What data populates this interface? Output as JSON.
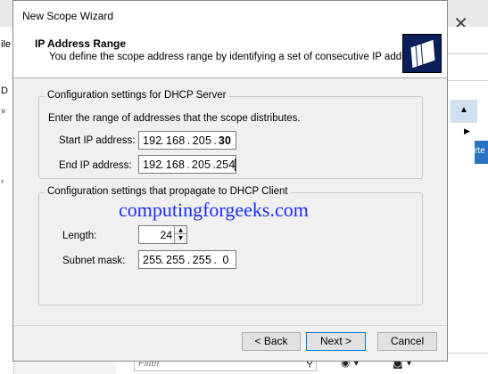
{
  "background": {
    "left_labels": [
      "ile",
      "D"
    ],
    "right_blue_text": "rte",
    "filter_placeholder": "Filter"
  },
  "dialog": {
    "title": "New Scope Wizard",
    "header": {
      "title": "IP Address Range",
      "description": "You define the scope address range by identifying a set of consecutive IP addresses."
    },
    "server_group": {
      "legend": "Configuration settings for DHCP Server",
      "instruction": "Enter the range of addresses that the scope distributes.",
      "start_label": "Start IP address:",
      "start_ip": [
        "192",
        "168",
        "205",
        "30"
      ],
      "end_label": "End IP address:",
      "end_ip": [
        "192",
        "168",
        "205",
        "254"
      ]
    },
    "client_group": {
      "legend": "Configuration settings that propagate to DHCP Client",
      "length_label": "Length:",
      "length_value": "24",
      "mask_label": "Subnet mask:",
      "subnet_mask": [
        "255",
        "255",
        "255",
        "0"
      ]
    },
    "watermark": "computingforgeeks.com",
    "buttons": {
      "back": "< Back",
      "next": "Next >",
      "cancel": "Cancel"
    }
  }
}
